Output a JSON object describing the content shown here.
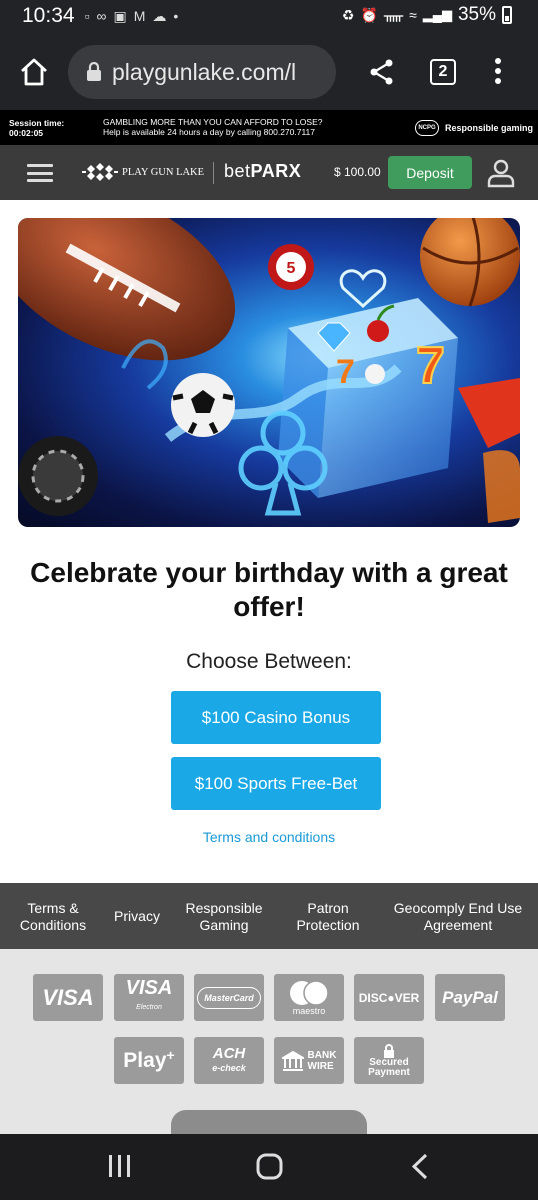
{
  "status_bar": {
    "time": "10:34",
    "battery": "35%"
  },
  "browser": {
    "url": "playgunlake.com/l",
    "tab_count": "2"
  },
  "notice": {
    "session_label": "Session time:",
    "session_value": "00:02:05",
    "gambling_line1": "GAMBLING MORE THAN YOU CAN AFFORD TO LOSE?",
    "gambling_line2": "Help is available 24 hours a day by calling 800.270.7117",
    "ncpg": "NCPG",
    "responsible": "Responsible gaming"
  },
  "header": {
    "logo_text": "PLAY GUN LAKE",
    "betparx_light": "bet",
    "betparx_bold": "PARX",
    "balance": "$ 100.00",
    "deposit_label": "Deposit"
  },
  "hero": {
    "chip_number": "5"
  },
  "promo": {
    "headline_line1": "Celebrate your birthday with a great",
    "headline_line2": "offer!",
    "choose": "Choose Between:",
    "offer1": "$100 Casino Bonus",
    "offer2": "$100 Sports Free-Bet",
    "terms": "Terms and conditions"
  },
  "footer_nav": {
    "terms_l1": "Terms &",
    "terms_l2": "Conditions",
    "privacy": "Privacy",
    "resp_l1": "Responsible",
    "resp_l2": "Gaming",
    "patron_l1": "Patron",
    "patron_l2": "Protection",
    "geo_l1": "Geocomply End Use",
    "geo_l2": "Agreement"
  },
  "payments": {
    "visa": "VISA",
    "visa_electron": "VISA",
    "visa_electron_sub": "Electron",
    "mastercard": "MasterCard",
    "maestro": "maestro",
    "discover": "DISC●VER",
    "paypal": "PayPal",
    "play": "Play",
    "ach": "ACH",
    "ach_sub": "e-check",
    "bank_l1": "BANK",
    "bank_l2": "WIRE",
    "secured_l1": "Secured",
    "secured_l2": "Payment"
  }
}
